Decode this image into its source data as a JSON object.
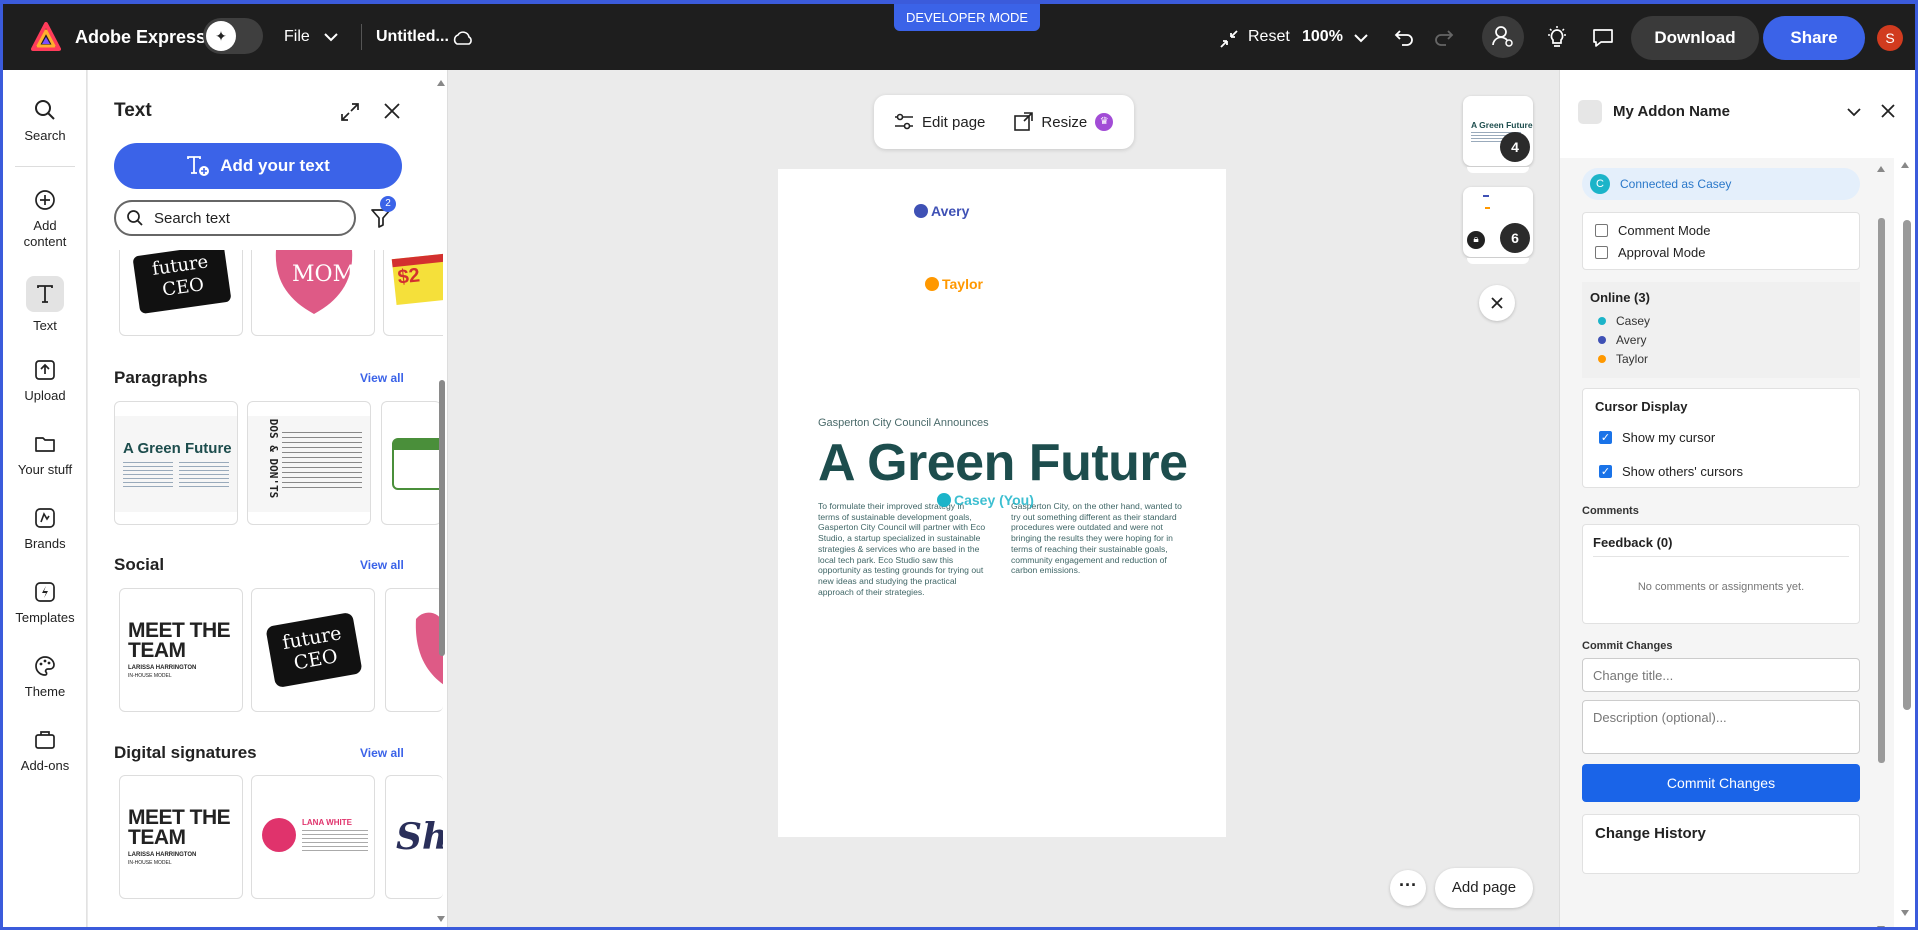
{
  "topbar": {
    "app_name": "Adobe Express",
    "file_label": "File",
    "doc_title": "Untitled...",
    "dev_mode": "DEVELOPER MODE",
    "reset_label": "Reset",
    "zoom": "100%",
    "download_label": "Download",
    "share_label": "Share",
    "avatar_initial": "S"
  },
  "rail": {
    "items": [
      {
        "label": "Search",
        "icon": "search-icon"
      },
      {
        "label": "Add content",
        "icon": "plus-circle-icon"
      },
      {
        "label": "Text",
        "icon": "text-icon"
      },
      {
        "label": "Upload",
        "icon": "upload-icon"
      },
      {
        "label": "Your stuff",
        "icon": "folder-icon"
      },
      {
        "label": "Brands",
        "icon": "brands-icon"
      },
      {
        "label": "Templates",
        "icon": "templates-icon"
      },
      {
        "label": "Theme",
        "icon": "palette-icon"
      },
      {
        "label": "Add-ons",
        "icon": "addons-icon"
      }
    ],
    "selected": "Text"
  },
  "panel": {
    "title": "Text",
    "add_button": "Add your text",
    "search_placeholder": "Search text",
    "filter_count": "2",
    "sections": [
      {
        "title": "Paragraphs",
        "view_all": "View all"
      },
      {
        "title": "Social",
        "view_all": "View all"
      },
      {
        "title": "Digital signatures",
        "view_all": "View all"
      }
    ],
    "thumbs": {
      "future_ceo_1": "future",
      "future_ceo_2": "CEO",
      "mom": "MOM",
      "price": "$2",
      "green_future": "A Green Future",
      "dos_donts": "DOS & DON'TS",
      "meet_1": "MEET THE",
      "meet_2": "TEAM",
      "meet_name": "LARISSA HARRINGTON",
      "meet_sub": "IN-HOUSE MODEL",
      "lana": "LANA WHITE",
      "sig_partial": "Sh"
    }
  },
  "canvas": {
    "edit_page": "Edit page",
    "resize": "Resize",
    "cursors": [
      {
        "name": "Avery",
        "color": "#3f51b5"
      },
      {
        "name": "Taylor",
        "color": "#ff9800"
      },
      {
        "name": "Casey (You)",
        "color": "#1cb4c9"
      }
    ],
    "page": {
      "kicker": "Gasperton City Council Announces",
      "headline": "A Green Future",
      "col1": "To formulate their improved strategy in terms of sustainable development goals, Gasperton City Council will partner with Eco Studio, a startup specialized in sustainable strategies & services who are based in the local tech park. Eco Studio saw this opportunity as testing grounds for trying out new ideas and studying the practical approach of their strategies.",
      "col2": "Gasperton City, on the other hand, wanted to try out something different as their standard procedures were outdated and were not bringing the results they were hoping for in terms of reaching their sustainable goals, community engagement and reduction of carbon emissions."
    },
    "page_counts": [
      "4",
      "6"
    ],
    "add_page": "Add page"
  },
  "addon": {
    "title": "My Addon Name",
    "connected_prefix": "Connected as",
    "connected_user": "Casey",
    "connected_initial": "C",
    "modes": [
      {
        "label": "Comment Mode",
        "checked": false
      },
      {
        "label": "Approval Mode",
        "checked": false
      }
    ],
    "online_title": "Online (3)",
    "online": [
      {
        "name": "Casey",
        "color": "#1cb4c9"
      },
      {
        "name": "Avery",
        "color": "#3f51b5"
      },
      {
        "name": "Taylor",
        "color": "#ff9800"
      }
    ],
    "cursor_display_title": "Cursor Display",
    "cursor_options": [
      {
        "label": "Show my cursor",
        "checked": true
      },
      {
        "label": "Show others' cursors",
        "checked": true
      }
    ],
    "comments_label": "Comments",
    "feedback_title": "Feedback (0)",
    "no_comments": "No comments or assignments yet.",
    "commit_label": "Commit Changes",
    "title_placeholder": "Change title...",
    "desc_placeholder": "Description (optional)...",
    "commit_button": "Commit Changes",
    "history_title": "Change History"
  }
}
